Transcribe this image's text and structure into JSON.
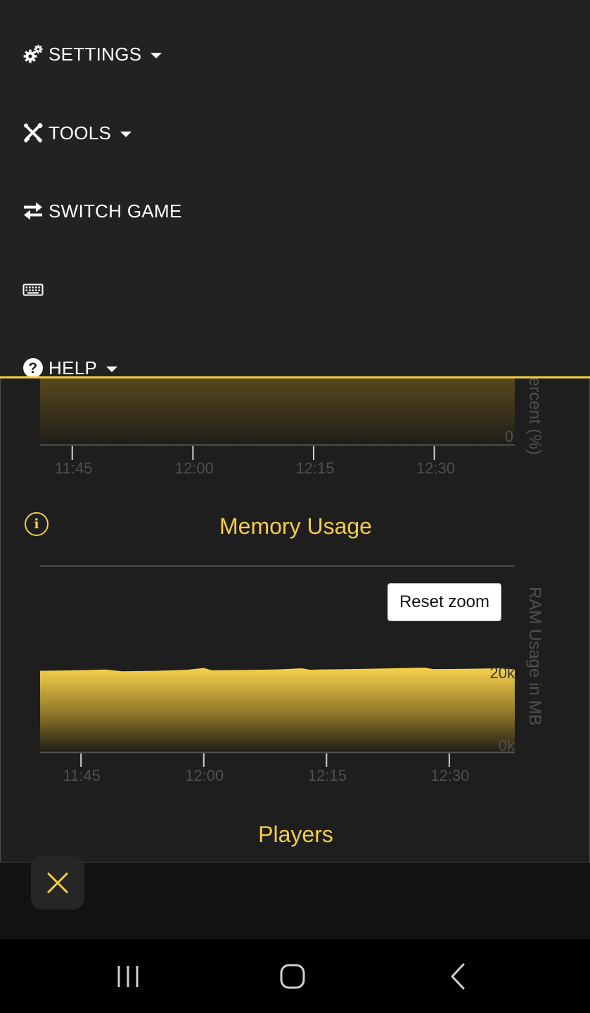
{
  "nav": {
    "settings": {
      "label": "SETTINGS",
      "icon": "cogs-icon"
    },
    "tools": {
      "label": "TOOLS",
      "icon": "tools-icon"
    },
    "switch_game": {
      "label": "SWITCH GAME",
      "icon": "exchange-icon"
    },
    "keyboard": {
      "icon": "keyboard-icon"
    },
    "help": {
      "label": "HELP",
      "icon": "question-circle-icon"
    }
  },
  "cpu_chart": {
    "ylabel_fragment": "ercent (%)",
    "y_tick_label": "0",
    "x_tick_labels": [
      "11:45",
      "12:00",
      "12:15",
      "12:30"
    ]
  },
  "memory": {
    "title": "Memory Usage",
    "reset_zoom_label": "Reset zoom",
    "info_icon": "info-circle-icon"
  },
  "players": {
    "title": "Players"
  },
  "colors": {
    "accent": "#f5cd45",
    "nav_bg": "#222222",
    "panel_bg": "#1e1e1e",
    "axis_text": "#5a5a5a"
  },
  "chart_data": [
    {
      "type": "area",
      "title": "",
      "xlabel": "",
      "ylabel": "ercent (%)",
      "x_ticks": [
        "11:45",
        "12:00",
        "12:15",
        "12:30"
      ],
      "y_ticks": [
        "0"
      ],
      "grid": false,
      "legend": "none",
      "note": "partially hidden by navigation menu"
    },
    {
      "type": "area",
      "title": "Memory Usage",
      "xlabel": "",
      "ylabel": "RAM Usage in MB",
      "x_ticks": [
        "11:45",
        "12:00",
        "12:15",
        "12:30"
      ],
      "y_ticks": [
        "0k",
        "20k"
      ],
      "grid": false,
      "legend": "none",
      "series": [
        {
          "x": [
            "11:40",
            "11:44",
            "11:48",
            "11:50",
            "11:54",
            "11:58",
            "12:00",
            "12:01",
            "12:05",
            "12:09",
            "12:12",
            "12:13",
            "12:14",
            "12:18",
            "12:22",
            "12:25",
            "12:27",
            "12:28",
            "12:32",
            "12:36",
            "12:38"
          ],
          "values": [
            22400,
            22550,
            22750,
            22300,
            22400,
            22700,
            23200,
            22550,
            22650,
            22800,
            23100,
            22700,
            22750,
            22900,
            23050,
            23200,
            23300,
            22900,
            22950,
            23100,
            22800
          ]
        }
      ]
    }
  ]
}
